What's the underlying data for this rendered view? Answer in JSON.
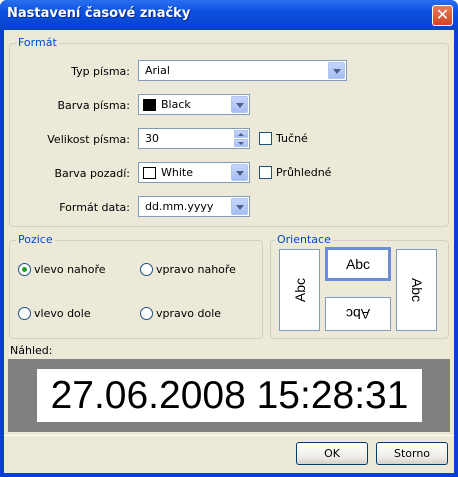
{
  "window": {
    "title": "Nastavení časové značky",
    "close_glyph": "✕"
  },
  "format": {
    "legend": "Formát",
    "font_type": {
      "label": "Typ písma:",
      "value": "Arial"
    },
    "font_color": {
      "label": "Barva písma:",
      "value": "Black",
      "swatch": "#000000"
    },
    "font_size": {
      "label": "Velikost písma:",
      "value": "30",
      "bold_label": "Tučné",
      "bold_checked": false
    },
    "bg_color": {
      "label": "Barva pozadí:",
      "value": "White",
      "swatch": "#ffffff",
      "transparent_label": "Průhledné",
      "transparent_checked": false
    },
    "date_format": {
      "label": "Formát data:",
      "value": "dd.mm.yyyy"
    }
  },
  "position": {
    "legend": "Pozice",
    "options": [
      {
        "label": "vlevo nahoře",
        "selected": true
      },
      {
        "label": "vpravo nahoře",
        "selected": false
      },
      {
        "label": "vlevo dole",
        "selected": false
      },
      {
        "label": "vpravo dole",
        "selected": false
      }
    ]
  },
  "orientation": {
    "legend": "Orientace",
    "sample": "Abc",
    "selected": "top"
  },
  "preview": {
    "label": "Náhled:",
    "text": "27.06.2008 15:28:31"
  },
  "buttons": {
    "ok": "OK",
    "cancel": "Storno"
  }
}
